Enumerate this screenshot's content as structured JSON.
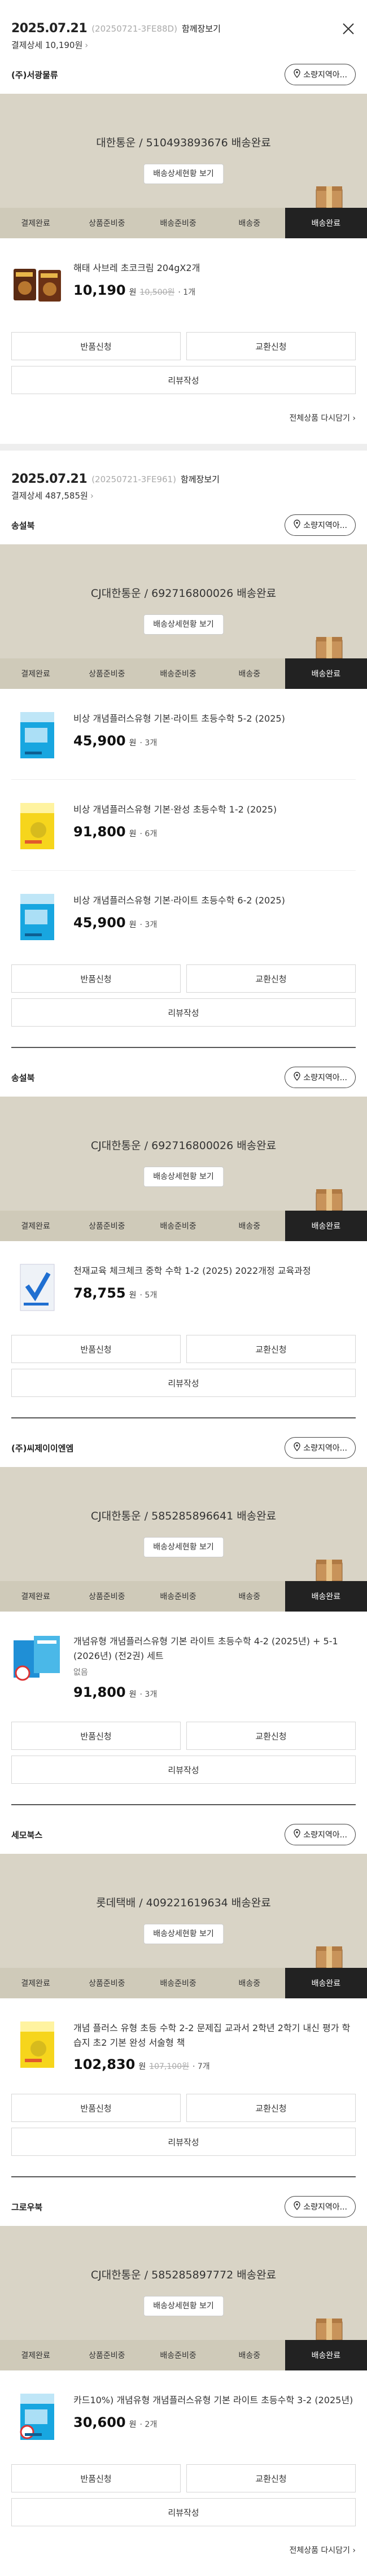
{
  "close_icon": "close-icon",
  "orders": [
    {
      "date": "2025.07.21",
      "order_no": "(20250721-3FE88D)",
      "link_label": "함께장보기",
      "total": "결제상세 10,190원",
      "groups": [
        {
          "seller": "(주)서광물류",
          "store_label": "소량지역아...",
          "ship_text": "대한통운 / 510493893676 배송완료",
          "ship_button": "배송상세현황 보기",
          "products": [
            {
              "name": "해태 사브레 초코크림 204gX2개",
              "price": "10,190",
              "won": "원",
              "old": "10,500원",
              "qty": "· 1개",
              "img": "cookie"
            }
          ]
        }
      ],
      "reorder": "전체상품 다시담기"
    },
    {
      "date": "2025.07.21",
      "order_no": "(20250721-3FE961)",
      "link_label": "함께장보기",
      "total": "결제상세 487,585원",
      "groups": [
        {
          "seller": "송설북",
          "store_label": "소량지역아...",
          "ship_text": "CJ대한통운 / 692716800026 배송완료",
          "ship_button": "배송상세현황 보기",
          "products": [
            {
              "name": "비상 개념플러스유형 기본·라이트 초등수학 5-2 (2025)",
              "price": "45,900",
              "won": "원",
              "qty": "· 3개",
              "img": "blue"
            },
            {
              "name": "비상 개념플러스유형 기본·완성 초등수학 1-2 (2025)",
              "price": "91,800",
              "won": "원",
              "qty": "· 6개",
              "img": "yellow"
            },
            {
              "name": "비상 개념플러스유형 기본·라이트 초등수학 6-2 (2025)",
              "price": "45,900",
              "won": "원",
              "qty": "· 3개",
              "img": "blue"
            }
          ]
        },
        {
          "seller": "송설북",
          "store_label": "소량지역아...",
          "ship_text": "CJ대한통운 / 692716800026 배송완료",
          "ship_button": "배송상세현황 보기",
          "products": [
            {
              "name": "천재교육 체크체크 중학 수학 1-2 (2025) 2022개정 교육과정",
              "price": "78,755",
              "won": "원",
              "qty": "· 5개",
              "img": "check"
            }
          ]
        },
        {
          "seller": "(주)씨제이이엔엠",
          "store_label": "소량지역아...",
          "ship_text": "CJ대한통운 / 585285896641 배송완료",
          "ship_button": "배송상세현황 보기",
          "products": [
            {
              "name": "개념유형 개념플러스유형 기본 라이트 초등수학 4-2 (2025년) + 5-1 (2026년) (전2권) 세트",
              "option": "없음",
              "price": "91,800",
              "won": "원",
              "qty": "· 3개",
              "img": "set"
            }
          ]
        },
        {
          "seller": "세모북스",
          "store_label": "소량지역아...",
          "ship_text": "롯데택배 / 409221619634 배송완료",
          "ship_button": "배송상세현황 보기",
          "products": [
            {
              "name": "개념 플러스 유형 초등 수학 2-2 문제집 교과서 2학년 2학기 내신 평가 학습지 초2 기본 완성 서술형 책",
              "price": "102,830",
              "won": "원",
              "old": "107,100원",
              "qty": "· 7개",
              "img": "yellow2"
            }
          ]
        },
        {
          "seller": "그로우북",
          "store_label": "소량지역아...",
          "ship_text": "CJ대한통운 / 585285897772 배송완료",
          "ship_button": "배송상세현황 보기",
          "products": [
            {
              "name": "카드10%) 개념유형 개념플러스유형 기본 라이트 초등수학 3-2 (2025년)",
              "price": "30,600",
              "won": "원",
              "qty": "· 2개",
              "img": "blue2"
            }
          ]
        }
      ],
      "reorder": "전체상품 다시담기"
    }
  ],
  "steps": [
    "결제완료",
    "상품준비중",
    "배송준비중",
    "배송중",
    "배송완료"
  ],
  "actions": {
    "return": "반품신청",
    "exchange": "교환신청",
    "review": "리뷰작성"
  },
  "colors": {
    "ship_bg": "#d9d4c6",
    "steps_bg": "#cfcab9",
    "active_step": "#222222"
  }
}
